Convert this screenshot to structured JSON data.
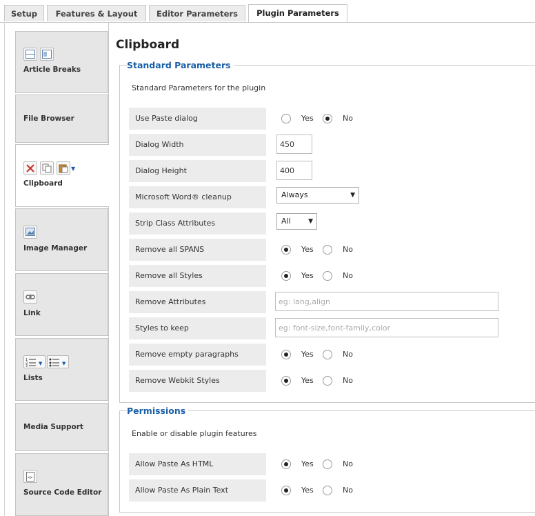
{
  "tabs": [
    {
      "label": "Setup"
    },
    {
      "label": "Features & Layout"
    },
    {
      "label": "Editor Parameters"
    },
    {
      "label": "Plugin Parameters"
    }
  ],
  "sidebar": {
    "items": [
      {
        "label": "Article Breaks"
      },
      {
        "label": "File Browser"
      },
      {
        "label": "Clipboard"
      },
      {
        "label": "Image Manager"
      },
      {
        "label": "Link"
      },
      {
        "label": "Lists"
      },
      {
        "label": "Media Support"
      },
      {
        "label": "Source Code Editor"
      }
    ]
  },
  "main": {
    "title": "Clipboard",
    "standard": {
      "legend": "Standard Parameters",
      "description": "Standard Parameters for the plugin",
      "rows": [
        {
          "label": "Use Paste dialog",
          "type": "radio",
          "yes": "Yes",
          "no": "No",
          "selected": "No"
        },
        {
          "label": "Dialog Width",
          "type": "input",
          "value": "450"
        },
        {
          "label": "Dialog Height",
          "type": "input",
          "value": "400"
        },
        {
          "label": "Microsoft Word® cleanup",
          "type": "select",
          "value": "Always"
        },
        {
          "label": "Strip Class Attributes",
          "type": "select",
          "value": "All"
        },
        {
          "label": "Remove all SPANS",
          "type": "radio",
          "yes": "Yes",
          "no": "No",
          "selected": "Yes"
        },
        {
          "label": "Remove all Styles",
          "type": "radio",
          "yes": "Yes",
          "no": "No",
          "selected": "Yes"
        },
        {
          "label": "Remove Attributes",
          "type": "text",
          "placeholder": "eg: lang,align"
        },
        {
          "label": "Styles to keep",
          "type": "text",
          "placeholder": "eg: font-size,font-family,color"
        },
        {
          "label": "Remove empty paragraphs",
          "type": "radio",
          "yes": "Yes",
          "no": "No",
          "selected": "Yes"
        },
        {
          "label": "Remove Webkit Styles",
          "type": "radio",
          "yes": "Yes",
          "no": "No",
          "selected": "Yes"
        }
      ]
    },
    "permissions": {
      "legend": "Permissions",
      "description": "Enable or disable plugin features",
      "rows": [
        {
          "label": "Allow Paste As HTML",
          "yes": "Yes",
          "no": "No",
          "selected": "Yes"
        },
        {
          "label": "Allow Paste As Plain Text",
          "yes": "Yes",
          "no": "No",
          "selected": "Yes"
        }
      ]
    }
  }
}
